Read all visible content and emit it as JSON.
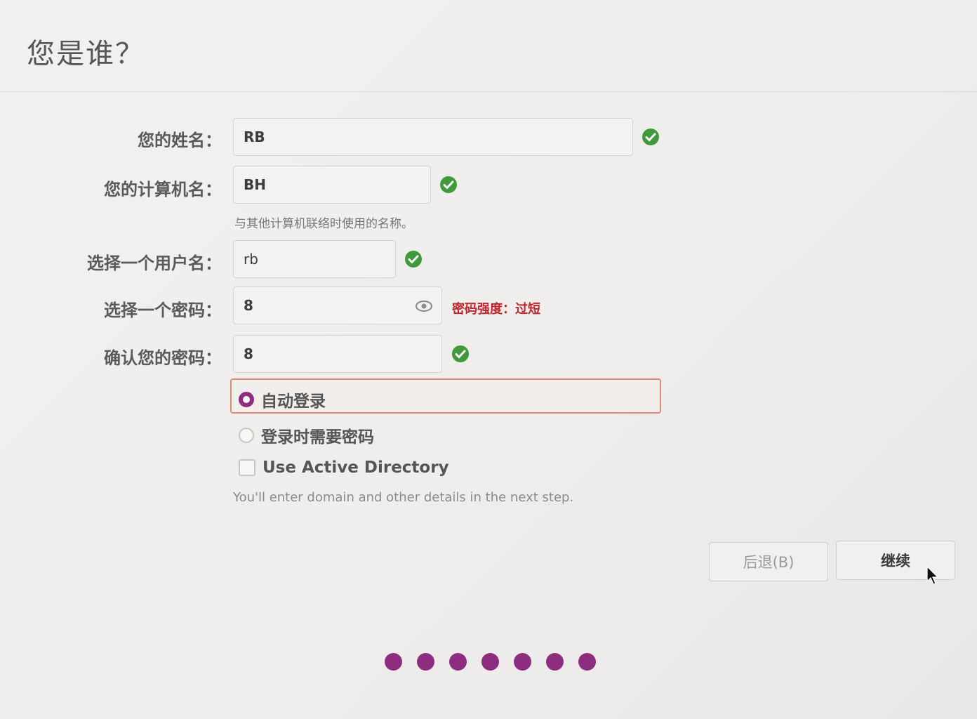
{
  "page": {
    "title": "您是谁？"
  },
  "form": {
    "name": {
      "label": "您的姓名：",
      "value": "RB"
    },
    "computer": {
      "label": "您的计算机名：",
      "value": "BH",
      "hint": "与其他计算机联络时使用的名称。"
    },
    "username": {
      "label": "选择一个用户名：",
      "value": "rb"
    },
    "password": {
      "label": "选择一个密码：",
      "value": "8",
      "strength": "密码强度：过短"
    },
    "confirm": {
      "label": "确认您的密码：",
      "value": "8"
    }
  },
  "options": {
    "auto_login": "自动登录",
    "require_password": "登录时需要密码",
    "active_directory": "Use Active Directory",
    "active_directory_hint": "You'll enter domain and other details in the next step."
  },
  "buttons": {
    "back": "后退(B)",
    "continue": "继续"
  },
  "progress": {
    "total_steps": 7
  },
  "colors": {
    "accent": "#8e2d80",
    "ok": "#3e9a3a",
    "error": "#c0262d"
  }
}
